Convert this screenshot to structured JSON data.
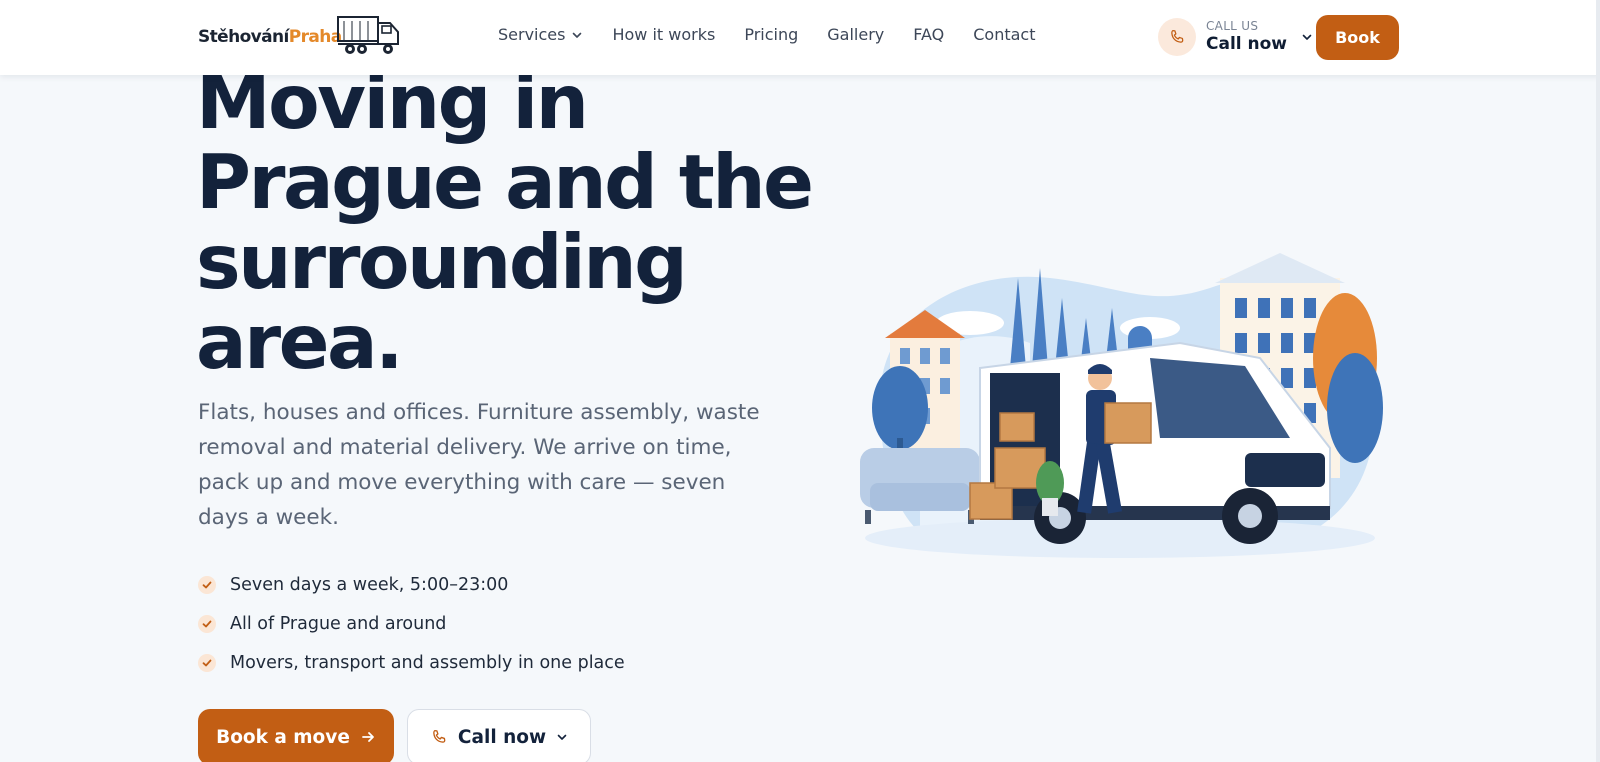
{
  "header": {
    "logo": {
      "text_main": "Stěhování",
      "text_accent": "Praha"
    },
    "nav": [
      {
        "label": "Services",
        "has_dropdown": true
      },
      {
        "label": "How it works"
      },
      {
        "label": "Pricing"
      },
      {
        "label": "Gallery"
      },
      {
        "label": "FAQ"
      },
      {
        "label": "Contact"
      }
    ],
    "call": {
      "small_label": "CALL US",
      "big_label": "Call now",
      "icon": "phone-icon"
    },
    "book_label": "Book"
  },
  "hero": {
    "title_lines": [
      "Moving in",
      "Prague and the",
      "surrounding",
      "area."
    ],
    "subtitle_lines": [
      "Flats, houses and offices. Furniture assembly, waste",
      "removal and material delivery. We arrive on time,",
      "pack up and move everything with care — seven",
      "days a week."
    ],
    "features": [
      "Seven days a week, 5:00–23:00",
      "All of Prague and around",
      "Movers, transport and assembly in one place"
    ],
    "cta_primary": "Book a move",
    "cta_secondary": "Call now"
  },
  "colors": {
    "accent": "#c25e14",
    "accent_light": "#fbe6d5",
    "heading": "#13223b",
    "background": "#f5f8fb"
  }
}
